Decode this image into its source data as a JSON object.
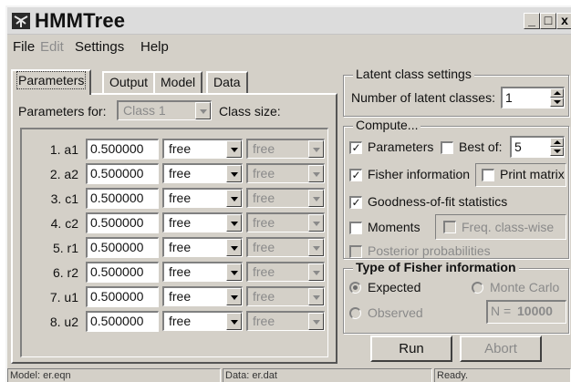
{
  "window": {
    "title": "HMMTree",
    "controls": {
      "minimize": "_",
      "maximize": "□",
      "close": "x"
    }
  },
  "menu": [
    "File",
    "Edit",
    "Settings",
    "Help"
  ],
  "tabs": [
    "Parameters",
    "Output",
    "Model",
    "Data"
  ],
  "parameters": {
    "for_label": "Parameters for:",
    "class_value": "Class 1",
    "class_size_label": "Class size:",
    "rows": [
      {
        "name": "1. a1",
        "value": "0.500000",
        "mode": "free",
        "mode2": "free"
      },
      {
        "name": "2. a2",
        "value": "0.500000",
        "mode": "free",
        "mode2": "free"
      },
      {
        "name": "3. c1",
        "value": "0.500000",
        "mode": "free",
        "mode2": "free"
      },
      {
        "name": "4. c2",
        "value": "0.500000",
        "mode": "free",
        "mode2": "free"
      },
      {
        "name": "5. r1",
        "value": "0.500000",
        "mode": "free",
        "mode2": "free"
      },
      {
        "name": "6. r2",
        "value": "0.500000",
        "mode": "free",
        "mode2": "free"
      },
      {
        "name": "7. u1",
        "value": "0.500000",
        "mode": "free",
        "mode2": "free"
      },
      {
        "name": "8. u2",
        "value": "0.500000",
        "mode": "free",
        "mode2": "free"
      }
    ]
  },
  "latent": {
    "legend": "Latent class settings",
    "num_label": "Number of latent classes:",
    "num_value": "1"
  },
  "compute": {
    "legend": "Compute...",
    "parameters": {
      "label": "Parameters",
      "checked": true
    },
    "best_of": {
      "label": "Best of:",
      "checked": false,
      "value": "5"
    },
    "fisher": {
      "label": "Fisher information",
      "checked": true
    },
    "print_matrix": {
      "label": "Print matrix",
      "checked": false
    },
    "gof": {
      "label": "Goodness-of-fit statistics",
      "checked": true
    },
    "moments": {
      "label": "Moments",
      "checked": false
    },
    "freq_classwise": {
      "label": "Freq. class-wise",
      "checked": false
    },
    "posterior": {
      "label": "Posterior probabilities",
      "checked": false
    },
    "check_mark": "✓"
  },
  "fisher_type": {
    "legend": "Type of Fisher information",
    "expected": {
      "label": "Expected",
      "selected": true
    },
    "monte_carlo": {
      "label": "Monte Carlo",
      "selected": false
    },
    "observed": {
      "label": "Observed",
      "selected": false
    },
    "n_label": "N =",
    "n_value": "10000"
  },
  "buttons": {
    "run": "Run",
    "abort": "Abort"
  },
  "status": {
    "model": "Model: er.eqn",
    "data": "Data: er.dat",
    "state": "Ready."
  },
  "colors": {
    "face": "#d4d0c8",
    "disabled_text": "#8a8a8a"
  }
}
